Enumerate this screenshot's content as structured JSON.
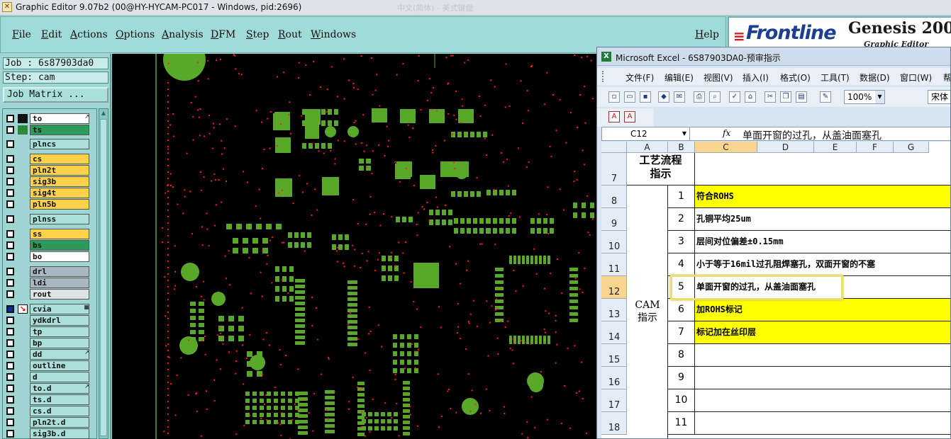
{
  "window": {
    "title": "Graphic Editor 9.07b2 (00@HY-HYCAM-PC017 - Windows, pid:2696)",
    "blurred_text": "中文(简体) - 美式键盘"
  },
  "menu": {
    "items": [
      "File",
      "Edit",
      "Actions",
      "Options",
      "Analysis",
      "DFM",
      "Step",
      "Rout",
      "Windows"
    ],
    "help": "Help"
  },
  "brand": {
    "frontline": "Frontline",
    "genesis": "Genesis 2000",
    "graphic_editor": "Graphic Editor"
  },
  "job": {
    "job_label": "Job : 6s87903da0",
    "step_label": "Step: cam",
    "job_matrix": "Job Matrix ..."
  },
  "layers": [
    {
      "name": "to",
      "icon": "black",
      "color": "#ffffff",
      "mark": "↗"
    },
    {
      "name": "ts",
      "icon": "green",
      "color": "#2d9a5a",
      "mark": ""
    },
    {
      "name": "plncs",
      "icon": "",
      "color": "#a9e0dc",
      "mark": ""
    },
    {
      "name": "cs",
      "icon": "",
      "color": "#ffd24a",
      "mark": ""
    },
    {
      "name": "pln2t",
      "icon": "",
      "color": "#ffd24a",
      "mark": ""
    },
    {
      "name": "sig3b",
      "icon": "",
      "color": "#ffd24a",
      "mark": ""
    },
    {
      "name": "sig4t",
      "icon": "",
      "color": "#ffd24a",
      "mark": ""
    },
    {
      "name": "pln5b",
      "icon": "",
      "color": "#ffd24a",
      "mark": ""
    },
    {
      "name": "plnss",
      "icon": "",
      "color": "#a9e0dc",
      "mark": ""
    },
    {
      "name": "ss",
      "icon": "",
      "color": "#ffd24a",
      "mark": ""
    },
    {
      "name": "bs",
      "icon": "",
      "color": "#2d9a5a",
      "mark": ""
    },
    {
      "name": "bo",
      "icon": "",
      "color": "#ffffff",
      "mark": ""
    },
    {
      "name": "drl",
      "icon": "",
      "color": "#a9b7c2",
      "mark": ""
    },
    {
      "name": "ldi",
      "icon": "",
      "color": "#a9b7c2",
      "mark": ""
    },
    {
      "name": "rout",
      "icon": "",
      "color": "#dfe3e6",
      "mark": ""
    },
    {
      "name": "cvia",
      "icon": "red",
      "color": "#a9e0dc",
      "mark": "▦",
      "dark": true
    },
    {
      "name": "ydkdrl",
      "icon": "",
      "color": "#a9e0dc",
      "mark": ""
    },
    {
      "name": "tp",
      "icon": "",
      "color": "#a9e0dc",
      "mark": ""
    },
    {
      "name": "bp",
      "icon": "",
      "color": "#a9e0dc",
      "mark": ""
    },
    {
      "name": "dd",
      "icon": "",
      "color": "#a9e0dc",
      "mark": "↗"
    },
    {
      "name": "outline",
      "icon": "",
      "color": "#a9e0dc",
      "mark": ""
    },
    {
      "name": "d",
      "icon": "",
      "color": "#a9e0dc",
      "mark": ""
    },
    {
      "name": "to.d",
      "icon": "",
      "color": "#a9e0dc",
      "mark": "↗"
    },
    {
      "name": "ts.d",
      "icon": "",
      "color": "#a9e0dc",
      "mark": ""
    },
    {
      "name": "cs.d",
      "icon": "",
      "color": "#a9e0dc",
      "mark": ""
    },
    {
      "name": "pln2t.d",
      "icon": "",
      "color": "#a9e0dc",
      "mark": ""
    },
    {
      "name": "sig3b.d",
      "icon": "",
      "color": "#a9e0dc",
      "mark": ""
    }
  ],
  "excel": {
    "title": "Microsoft Excel - 6S87903DA0-预审指示",
    "menu": [
      "文件(F)",
      "编辑(E)",
      "视图(V)",
      "插入(I)",
      "格式(O)",
      "工具(T)",
      "数据(D)",
      "窗口(W)",
      "帮"
    ],
    "zoom": "100%",
    "font": "宋体",
    "name_box": "C12",
    "fx": "fx",
    "formula": "单面开窗的过孔，从盖油面塞孔",
    "columns": [
      "A",
      "B",
      "C",
      "D",
      "E",
      "F",
      "G"
    ],
    "header_cell": "工艺流程\n指示",
    "cam_cell": "CAM\n指示",
    "rows": [
      {
        "row": "7"
      },
      {
        "row": "8",
        "num": "1",
        "text": "符合ROHS",
        "yellow": true
      },
      {
        "row": "9",
        "num": "2",
        "text": "孔铜平均25um",
        "yellow": false
      },
      {
        "row": "10",
        "num": "3",
        "text": "层间对位偏差±0.15mm",
        "yellow": false
      },
      {
        "row": "11",
        "num": "4",
        "text": "小于等于16mil过孔阻焊塞孔，双面开窗的不塞",
        "yellow": false
      },
      {
        "row": "12",
        "num": "5",
        "text": "单面开窗的过孔，从盖油面塞孔",
        "yellow": false
      },
      {
        "row": "13",
        "num": "6",
        "text": "加ROHS标记",
        "yellow": true
      },
      {
        "row": "14",
        "num": "7",
        "text": "标记加在丝印层",
        "yellow": true
      },
      {
        "row": "15",
        "num": "8",
        "text": "",
        "yellow": false
      },
      {
        "row": "16",
        "num": "9",
        "text": "",
        "yellow": false
      },
      {
        "row": "17",
        "num": "10",
        "text": "",
        "yellow": false
      },
      {
        "row": "18",
        "num": "11",
        "text": "",
        "yellow": false
      }
    ]
  },
  "colors": {
    "panel": "#9fd6d3",
    "pad_green": "#5aa82a",
    "drill_red": "#ff2020",
    "highlight_yellow": "#ffff00"
  }
}
